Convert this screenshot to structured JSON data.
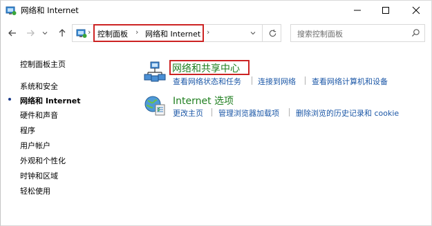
{
  "window": {
    "title": "网络和 Internet",
    "accent": "#cc2222",
    "link_color": "#1a56a6",
    "heading_color": "#1e7e1e"
  },
  "nav": {
    "back_icon": "arrow-left-icon",
    "forward_icon": "arrow-right-icon",
    "recent_icon": "chevron-down-icon",
    "up_icon": "arrow-up-icon",
    "refresh_icon": "refresh-icon",
    "breadcrumb": [
      "控制面板",
      "网络和 Internet"
    ],
    "search_placeholder": "搜索控制面板"
  },
  "sidebar": {
    "items": [
      {
        "label": "控制面板主页",
        "current": false
      },
      {
        "label": "系统和安全",
        "current": false
      },
      {
        "label": "网络和 Internet",
        "current": true
      },
      {
        "label": "硬件和声音",
        "current": false
      },
      {
        "label": "程序",
        "current": false
      },
      {
        "label": "用户帐户",
        "current": false
      },
      {
        "label": "外观和个性化",
        "current": false
      },
      {
        "label": "时钟和区域",
        "current": false
      },
      {
        "label": "轻松使用",
        "current": false
      }
    ]
  },
  "main": {
    "categories": [
      {
        "title": "网络和共享中心",
        "icon": "network-sharing-center-icon",
        "links": [
          "查看网络状态和任务",
          "连接到网络",
          "查看网络计算机和设备"
        ]
      },
      {
        "title": "Internet 选项",
        "icon": "internet-options-icon",
        "links": [
          "更改主页",
          "管理浏览器加载项",
          "删除浏览的历史记录和 cookie"
        ]
      }
    ]
  }
}
